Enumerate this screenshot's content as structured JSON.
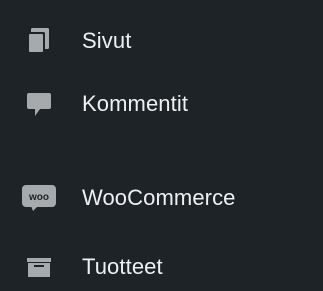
{
  "sidebar": {
    "items": [
      {
        "id": "pages",
        "label": "Sivut",
        "icon": "pages-icon"
      },
      {
        "id": "comments",
        "label": "Kommentit",
        "icon": "comment-icon"
      },
      {
        "id": "woocommerce",
        "label": "WooCommerce",
        "icon": "woo-icon",
        "icon_text": "woo"
      },
      {
        "id": "products",
        "label": "Tuotteet",
        "icon": "archive-icon"
      }
    ]
  },
  "colors": {
    "background": "#1d2327",
    "icon": "#a7aaad",
    "text": "#f0f0f1"
  }
}
